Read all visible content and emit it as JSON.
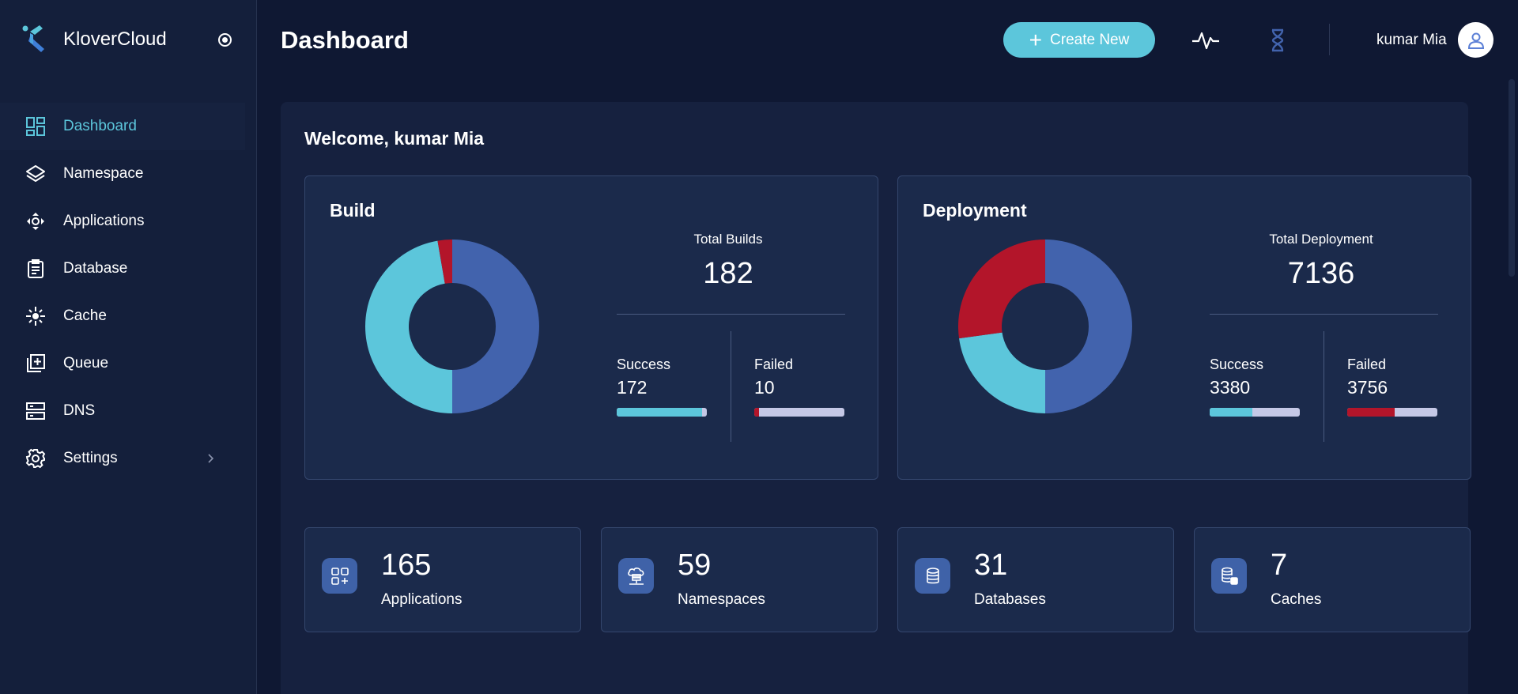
{
  "brand": {
    "name": "KloverCloud"
  },
  "sidebar": {
    "items": [
      {
        "label": "Dashboard",
        "icon": "dashboard-icon",
        "active": true
      },
      {
        "label": "Namespace",
        "icon": "layers-icon"
      },
      {
        "label": "Applications",
        "icon": "applications-icon"
      },
      {
        "label": "Database",
        "icon": "clipboard-icon"
      },
      {
        "label": "Cache",
        "icon": "cache-icon"
      },
      {
        "label": "Queue",
        "icon": "queue-icon"
      },
      {
        "label": "DNS",
        "icon": "server-icon"
      },
      {
        "label": "Settings",
        "icon": "gear-icon"
      }
    ]
  },
  "header": {
    "title": "Dashboard",
    "create_label": "Create New",
    "user_name": "kumar Mia"
  },
  "main": {
    "welcome": "Welcome, kumar Mia"
  },
  "build": {
    "title": "Build",
    "total_label": "Total Builds",
    "total": "182",
    "success_label": "Success",
    "success": "172",
    "failed_label": "Failed",
    "failed": "10",
    "success_ratio": 0.945,
    "failed_ratio": 0.055,
    "donut": [
      {
        "label": "segment-a",
        "value": 50,
        "color": "#4263ad"
      },
      {
        "label": "segment-b",
        "value": 47.3,
        "color": "#5cc6db"
      },
      {
        "label": "failed",
        "value": 2.7,
        "color": "#b3152a"
      }
    ]
  },
  "deployment": {
    "title": "Deployment",
    "total_label": "Total Deployment",
    "total": "7136",
    "success_label": "Success",
    "success": "3380",
    "failed_label": "Failed",
    "failed": "3756",
    "success_ratio": 0.474,
    "failed_ratio": 0.526,
    "donut": [
      {
        "label": "segment-a",
        "value": 50,
        "color": "#4263ad"
      },
      {
        "label": "segment-b",
        "value": 22.8,
        "color": "#5cc6db"
      },
      {
        "label": "failed",
        "value": 27.2,
        "color": "#b3152a"
      }
    ]
  },
  "tiles": [
    {
      "value": "165",
      "label": "Applications",
      "icon": "apps-grid-icon"
    },
    {
      "value": "59",
      "label": "Namespaces",
      "icon": "cloud-network-icon"
    },
    {
      "value": "31",
      "label": "Databases",
      "icon": "database-icon"
    },
    {
      "value": "7",
      "label": "Caches",
      "icon": "cache-db-icon"
    }
  ],
  "colors": {
    "accent": "#5cc6db",
    "primary": "#4263ad",
    "failed": "#b3152a",
    "bar_track": "#c5c8e6"
  }
}
